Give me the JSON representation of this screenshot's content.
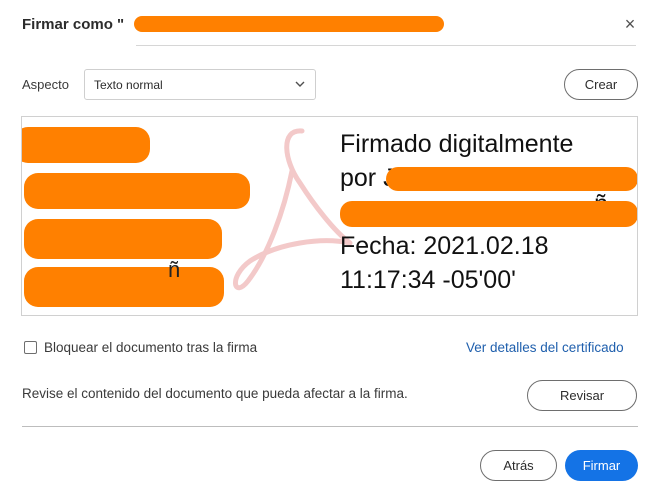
{
  "dialog": {
    "title_prefix": "Firmar como \"",
    "title_suffix": "\"",
    "close_glyph": "×"
  },
  "aspect": {
    "label": "Aspecto",
    "selected": "Texto normal",
    "create_button": "Crear"
  },
  "preview": {
    "line1": "Firmado digitalmente",
    "line2": "por J",
    "line3_fragment": "ñ",
    "line4": "Fecha: 2021.02.18",
    "line5": "11:17:34 -05'00'",
    "left_fragment": "ñ"
  },
  "lock_option": {
    "label": "Bloquear el documento tras la firma",
    "checked": false
  },
  "cert_link": "Ver detalles del certificado",
  "review": {
    "notice": "Revise el contenido del documento que pueda afectar a la firma.",
    "button": "Revisar"
  },
  "footer": {
    "back_button": "Atrás",
    "sign_button": "Firmar"
  },
  "colors": {
    "accent": "#1473e6",
    "link": "#1f5fad",
    "redaction": "#ff8000",
    "logo": "#f3c9c9"
  },
  "icons": [
    "close-icon",
    "chevron-down-icon",
    "acrobat-logo-icon",
    "checkbox-icon"
  ]
}
